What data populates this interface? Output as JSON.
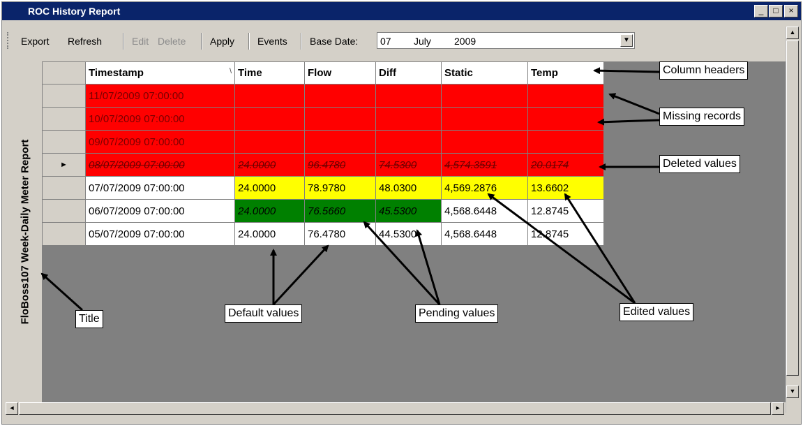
{
  "window": {
    "title": "ROC History Report",
    "controls": {
      "minimize": "_",
      "maximize": "□",
      "close": "×"
    }
  },
  "toolbar": {
    "export": "Export",
    "refresh": "Refresh",
    "edit": "Edit",
    "delete": "Delete",
    "apply": "Apply",
    "events": "Events",
    "base_date_label": "Base Date:",
    "base_date": {
      "day": "07",
      "month": "July",
      "year": "2009"
    }
  },
  "report_title": "FloBoss107 Week-Daily Meter Report",
  "grid": {
    "columns": [
      "Timestamp",
      "Time",
      "Flow",
      "Diff",
      "Static",
      "Temp"
    ],
    "sort_indicator": "\\",
    "current_row_marker": "►",
    "rows": [
      {
        "state": "missing",
        "cells": [
          "11/07/2009 07:00:00",
          "",
          "",
          "",
          "",
          ""
        ]
      },
      {
        "state": "missing",
        "cells": [
          "10/07/2009 07:00:00",
          "",
          "",
          "",
          "",
          ""
        ]
      },
      {
        "state": "missing",
        "cells": [
          "09/07/2009 07:00:00",
          "",
          "",
          "",
          "",
          ""
        ]
      },
      {
        "state": "deleted",
        "cells": [
          "08/07/2009 07:00:00",
          "24.0000",
          "96.4780",
          "74.5300",
          "4,574.3591",
          "20.0174"
        ]
      },
      {
        "state": "mixed",
        "cells": [
          "07/07/2009 07:00:00",
          "24.0000",
          "78.9780",
          "48.0300",
          "4,569.2876",
          "13.6602"
        ]
      },
      {
        "state": "mixed",
        "cells": [
          "06/07/2009 07:00:00",
          "24.0000",
          "76.5660",
          "45.5300",
          "4,568.6448",
          "12.8745"
        ]
      },
      {
        "state": "normal",
        "cells": [
          "05/07/2009 07:00:00",
          "24.0000",
          "76.4780",
          "44.5300",
          "4,568.6448",
          "12.8745"
        ]
      }
    ]
  },
  "callouts": {
    "column_headers": "Column headers",
    "missing_records": "Missing records",
    "deleted_values": "Deleted values",
    "title": "Title",
    "default_values": "Default values",
    "pending_values": "Pending values",
    "edited_values": "Edited values"
  },
  "colors": {
    "missing": "#ff0000",
    "edited": "#ffff00",
    "pending": "#008000",
    "titlebar": "#0a246a"
  }
}
